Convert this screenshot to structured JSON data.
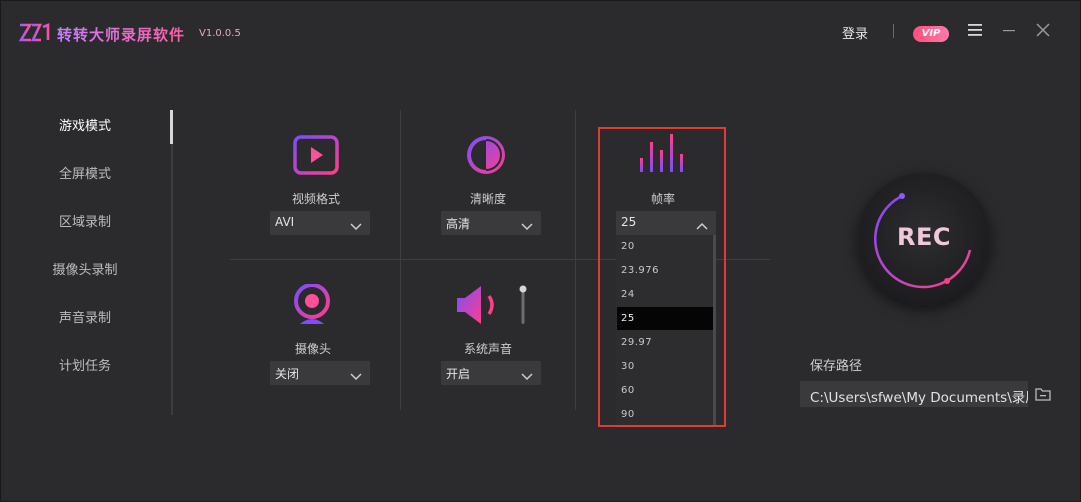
{
  "app": {
    "title": "转转大师录屏软件",
    "version": "V1.0.0.5",
    "login_label": "登录",
    "vip_label": "VIP"
  },
  "sidebar": {
    "items": [
      {
        "label": "游戏模式",
        "active": true
      },
      {
        "label": "全屏模式"
      },
      {
        "label": "区域录制"
      },
      {
        "label": "摄像头录制"
      },
      {
        "label": "声音录制"
      },
      {
        "label": "计划任务"
      }
    ]
  },
  "settings": {
    "video_format": {
      "label": "视频格式",
      "value": "AVI",
      "icon": "video-play-icon"
    },
    "quality": {
      "label": "清晰度",
      "value": "高清",
      "icon": "quality-circle-icon"
    },
    "frame_rate": {
      "label": "帧率",
      "value": "25",
      "icon": "equalizer-icon",
      "options": [
        "20",
        "23.976",
        "24",
        "25",
        "29.97",
        "30",
        "60",
        "90"
      ],
      "selected": "25"
    },
    "camera": {
      "label": "摄像头",
      "value": "关闭",
      "icon": "webcam-icon"
    },
    "system_sound": {
      "label": "系统声音",
      "value": "开启",
      "icon": "speaker-icon"
    }
  },
  "record": {
    "label": "REC"
  },
  "save": {
    "label": "保存路径",
    "path": "C:\\Users\\sfwe\\My Documents\\录屏"
  },
  "colors": {
    "background": "#2b2b2e",
    "accent_purple": "#7b4dff",
    "accent_pink": "#ff3e8a",
    "highlight_red": "#e53935"
  }
}
